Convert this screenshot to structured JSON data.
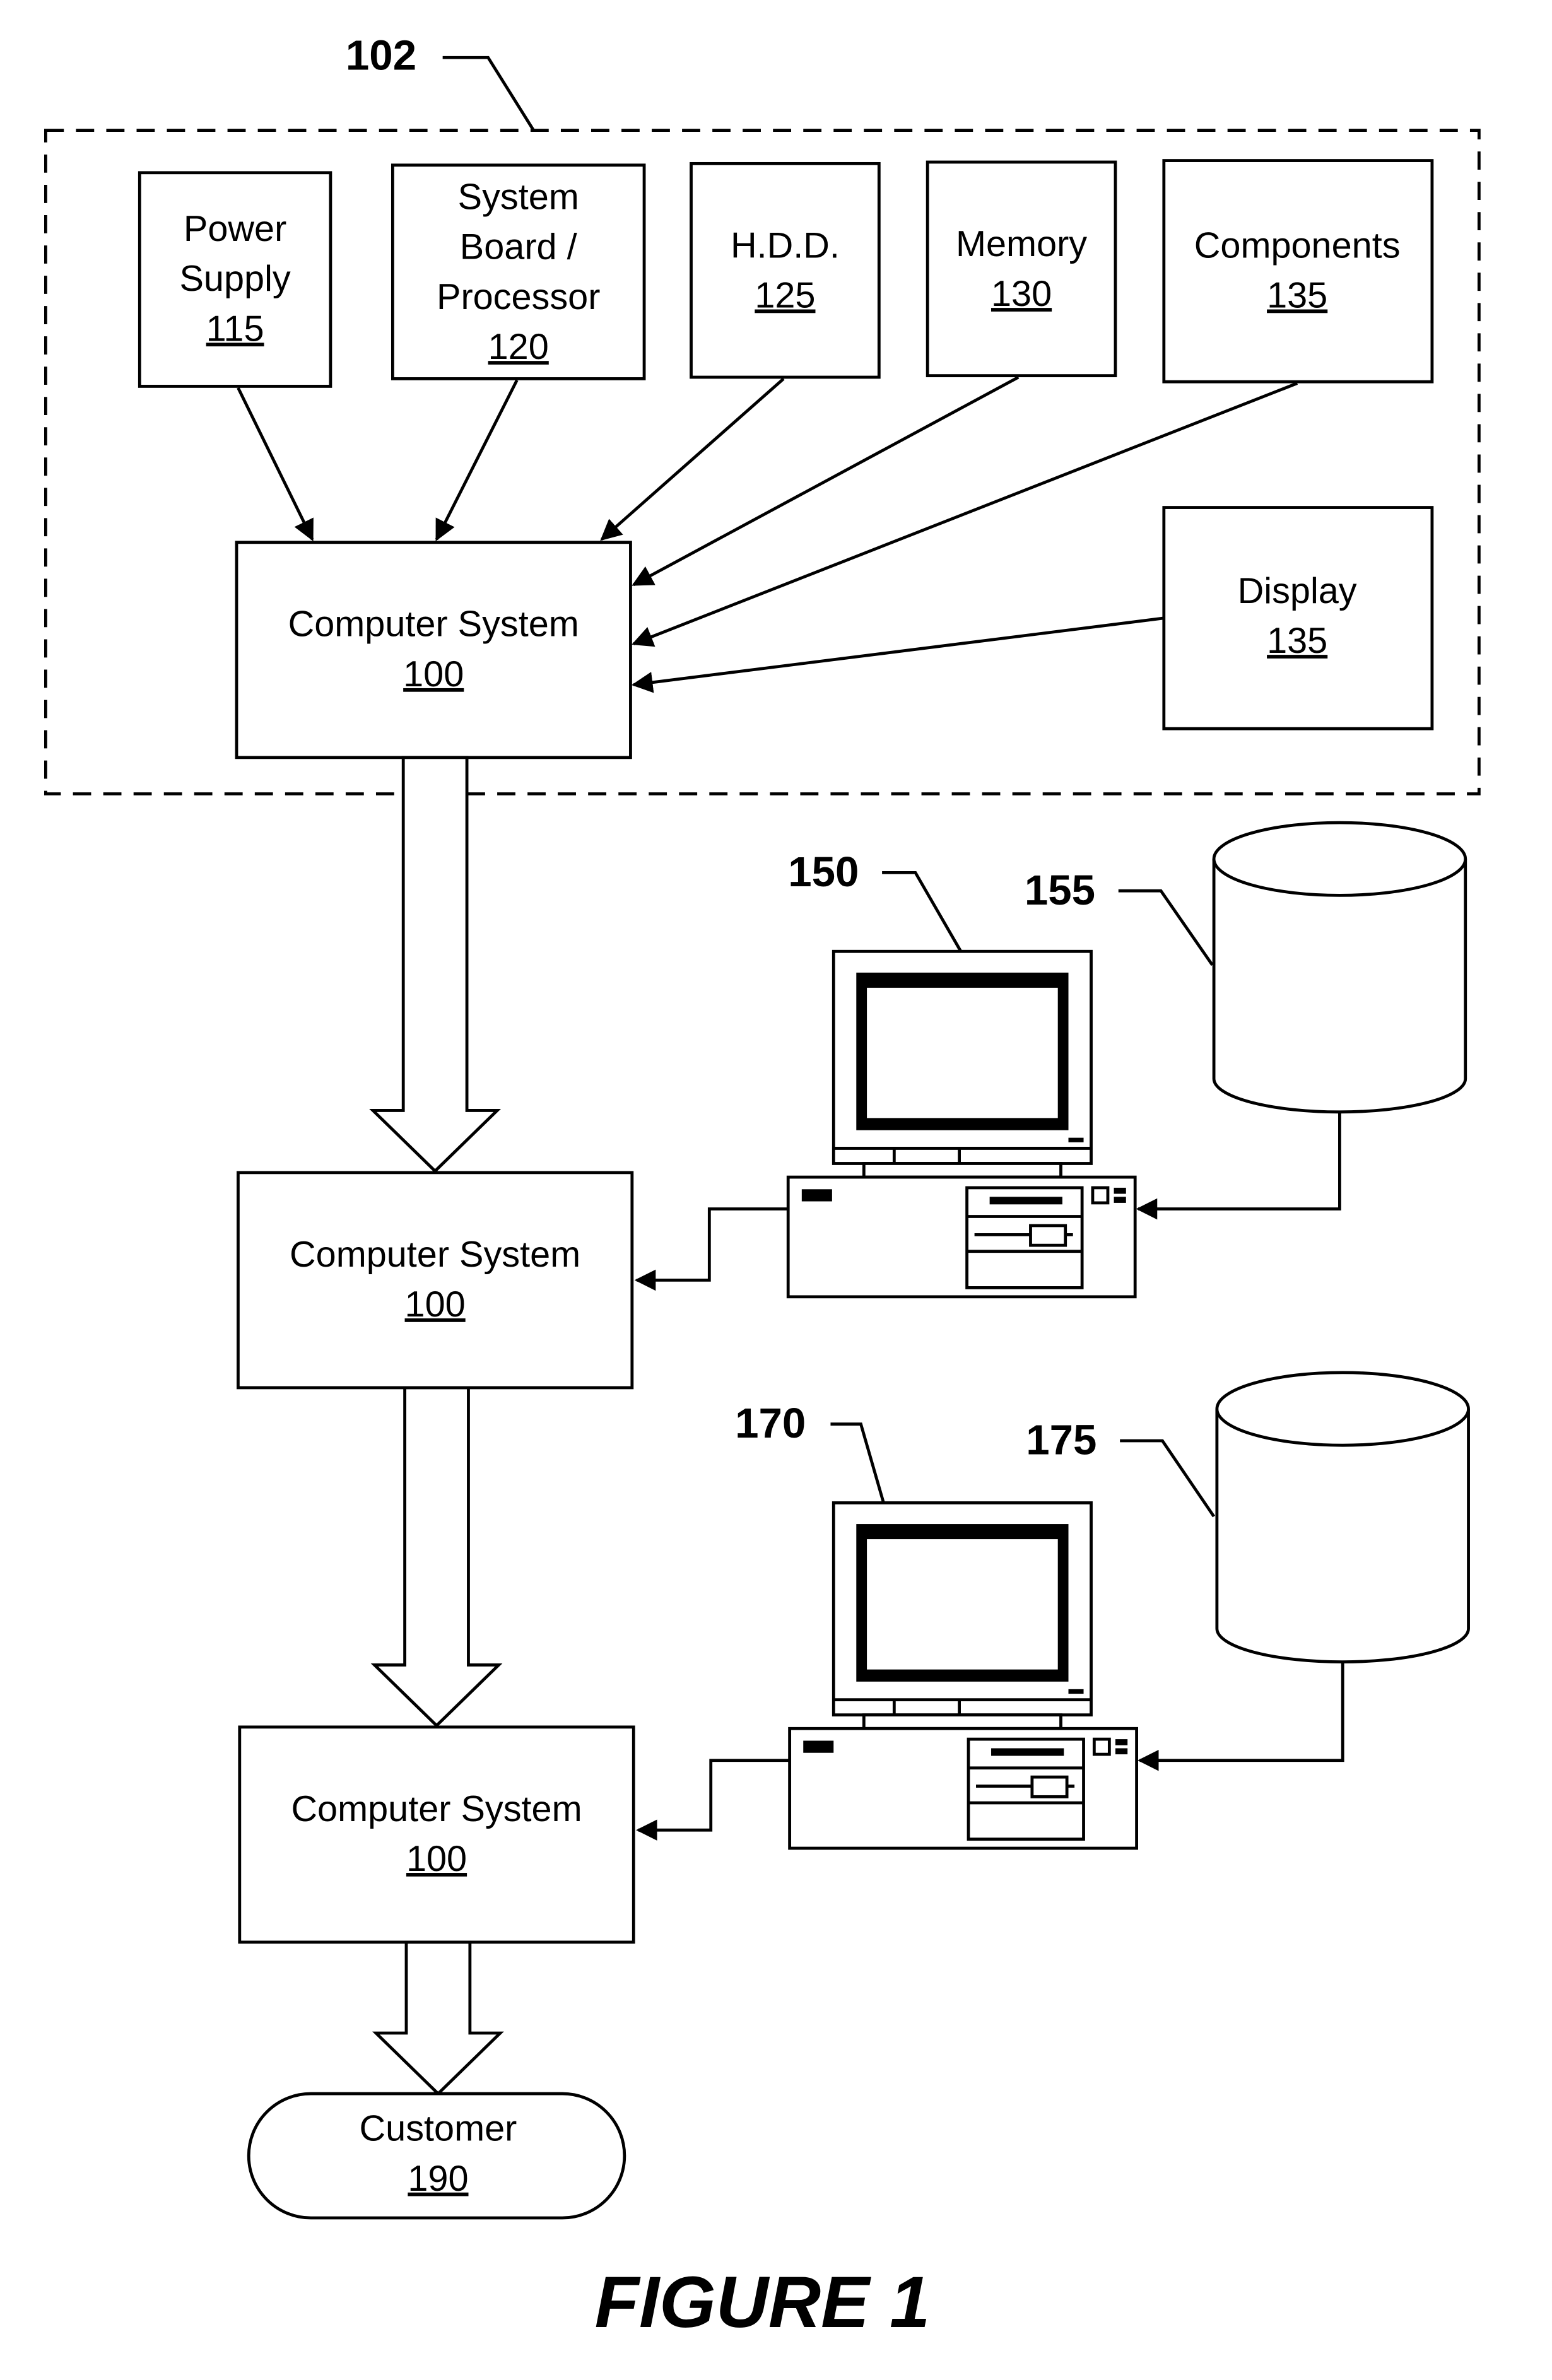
{
  "figure": {
    "caption": "FIGURE 1",
    "callouts": {
      "system_group": "102",
      "workstation_1": "150",
      "database_1": "155",
      "workstation_2": "170",
      "database_2": "175"
    },
    "components": [
      {
        "lines": [
          "Power",
          "Supply"
        ],
        "ref": "115"
      },
      {
        "lines": [
          "System",
          "Board /",
          "Processor"
        ],
        "ref": "120"
      },
      {
        "lines": [
          "H.D.D."
        ],
        "ref": "125"
      },
      {
        "lines": [
          "Memory"
        ],
        "ref": "130"
      },
      {
        "lines": [
          "Components"
        ],
        "ref": "135"
      },
      {
        "lines": [
          "Display"
        ],
        "ref": "135"
      }
    ],
    "computer_systems": [
      {
        "label": "Computer System",
        "ref": "100"
      },
      {
        "label": "Computer System",
        "ref": "100"
      },
      {
        "label": "Computer System",
        "ref": "100"
      }
    ],
    "customer": {
      "label": "Customer",
      "ref": "190"
    }
  }
}
